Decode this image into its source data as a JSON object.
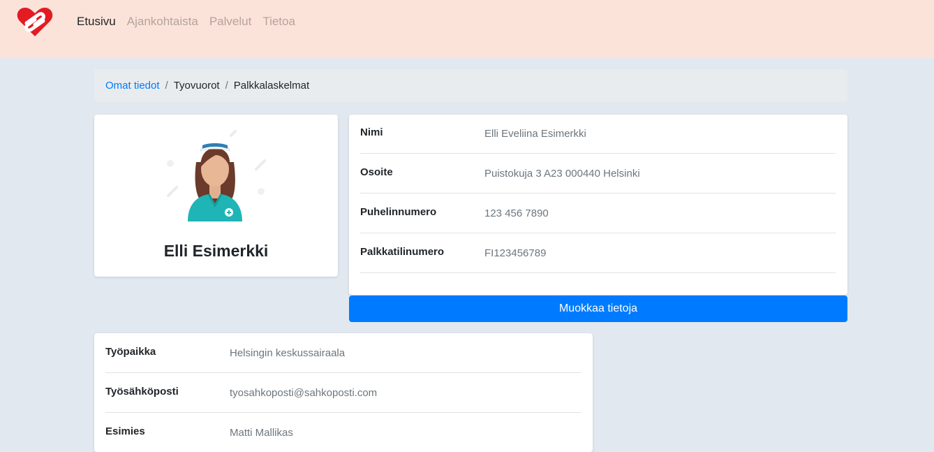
{
  "nav": {
    "logo": "heart-logo-icon",
    "items": [
      {
        "label": "Etusivu",
        "active": true
      },
      {
        "label": "Ajankohtaista",
        "active": false
      },
      {
        "label": "Palvelut",
        "active": false
      },
      {
        "label": "Tietoa",
        "active": false
      }
    ]
  },
  "breadcrumb": {
    "link": "Omat tiedot",
    "items": [
      "Tyovuorot",
      "Palkkalaskelmat"
    ]
  },
  "profile": {
    "avatar": "nurse-avatar-icon",
    "name": "Elli Esimerkki"
  },
  "personal_info": [
    {
      "label": "Nimi",
      "value": "Elli Eveliina Esimerkki"
    },
    {
      "label": "Osoite",
      "value": "Puistokuja 3 A23 000440 Helsinki"
    },
    {
      "label": "Puhelinnumero",
      "value": "123 456 7890"
    },
    {
      "label": "Palkkatilinumero",
      "value": "FI123456789"
    }
  ],
  "edit_button": "Muokkaa tietoja",
  "work_info": [
    {
      "label": "Työpaikka",
      "value": "Helsingin keskussairaala"
    },
    {
      "label": "Työsähköposti",
      "value": "tyosahkoposti@sahkoposti.com"
    },
    {
      "label": "Esimies",
      "value": "Matti Mallikas"
    }
  ],
  "colors": {
    "topbar": "#fce3d9",
    "page_bg": "#e2e8f0",
    "accent": "#007bff",
    "logo": "#e31b23"
  }
}
